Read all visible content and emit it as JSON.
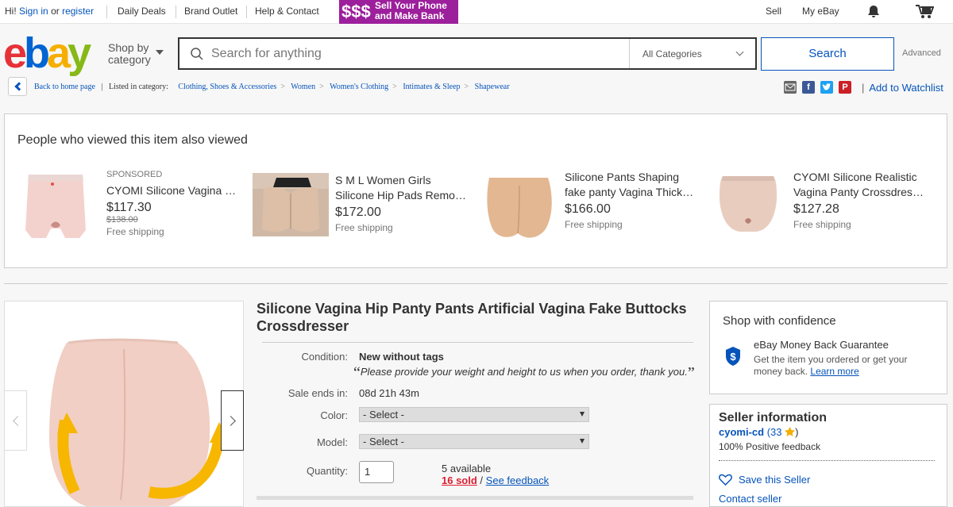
{
  "topnav": {
    "greeting": "Hi!",
    "sign_in": "Sign in",
    "or": "or",
    "register": "register",
    "daily_deals": "Daily Deals",
    "brand_outlet": "Brand Outlet",
    "help_contact": "Help & Contact",
    "banner_dollars": "$$$",
    "banner_line1": "Sell Your Phone",
    "banner_line2": "and Make Bank",
    "sell": "Sell",
    "my_ebay": "My eBay"
  },
  "header": {
    "logo": [
      "e",
      "b",
      "a",
      "y"
    ],
    "shop_by_line1": "Shop by",
    "shop_by_line2": "category",
    "search_placeholder": "Search for anything",
    "category": "All Categories",
    "search_button": "Search",
    "advanced": "Advanced"
  },
  "breadcrumb": {
    "back": "Back to home page",
    "listed": "Listed in category:",
    "items": [
      "Clothing, Shoes & Accessories",
      "Women",
      "Women's Clothing",
      "Intimates & Sleep",
      "Shapewear"
    ]
  },
  "social": {
    "add_to_watchlist": "Add to Watchlist"
  },
  "also_viewed": {
    "heading": "People who viewed this item also viewed",
    "items": [
      {
        "sponsored": "SPONSORED",
        "title": "CYOMI Silicone Vagina Panty",
        "price": "$117.30",
        "was": "$138.00",
        "shipping": "Free shipping"
      },
      {
        "title_line1": "S M L Women Girls",
        "title_line2": "Silicone Hip Pads Removable",
        "price": "$172.00",
        "shipping": "Free shipping"
      },
      {
        "title_line1": "Silicone Pants Shaping",
        "title_line2": "fake panty Vagina Thick Hip",
        "price": "$166.00",
        "shipping": "Free shipping"
      },
      {
        "title_line1": "CYOMI Silicone Realistic",
        "title_line2": "Vagina Panty Crossdresser",
        "price": "$127.28",
        "shipping": "Free shipping"
      }
    ]
  },
  "item": {
    "title": "Silicone Vagina Hip Panty Pants Artificial Vagina Fake Buttocks Crossdresser",
    "condition_label": "Condition:",
    "condition": "New without tags",
    "condition_note": "Please provide your weight and height to us when you order, thank you.",
    "sale_ends_label": "Sale ends in:",
    "sale_ends": "08d 21h 43m",
    "color_label": "Color:",
    "color_value": "- Select -",
    "model_label": "Model:",
    "model_value": "- Select -",
    "quantity_label": "Quantity:",
    "quantity": "1",
    "available": "5 available",
    "sold": "16 sold",
    "slash": "/",
    "see_feedback": "See feedback"
  },
  "confidence": {
    "heading": "Shop with confidence",
    "guarantee": "eBay Money Back Guarantee",
    "desc": "Get the item you ordered or get your money back.",
    "learn_more": "Learn more"
  },
  "seller": {
    "heading": "Seller information",
    "name": "cyomi-cd",
    "open": "(",
    "count": "33",
    "close": ")",
    "positive": "100% Positive feedback",
    "save": "Save this Seller",
    "contact": "Contact seller"
  },
  "colors": {
    "ebay_red": "#e53238",
    "ebay_blue": "#0064d2",
    "ebay_yellow": "#f5af02",
    "ebay_green": "#86b817",
    "link": "#0654ba",
    "banner": "#9c1f9c",
    "sold_red": "#dd1e31"
  }
}
